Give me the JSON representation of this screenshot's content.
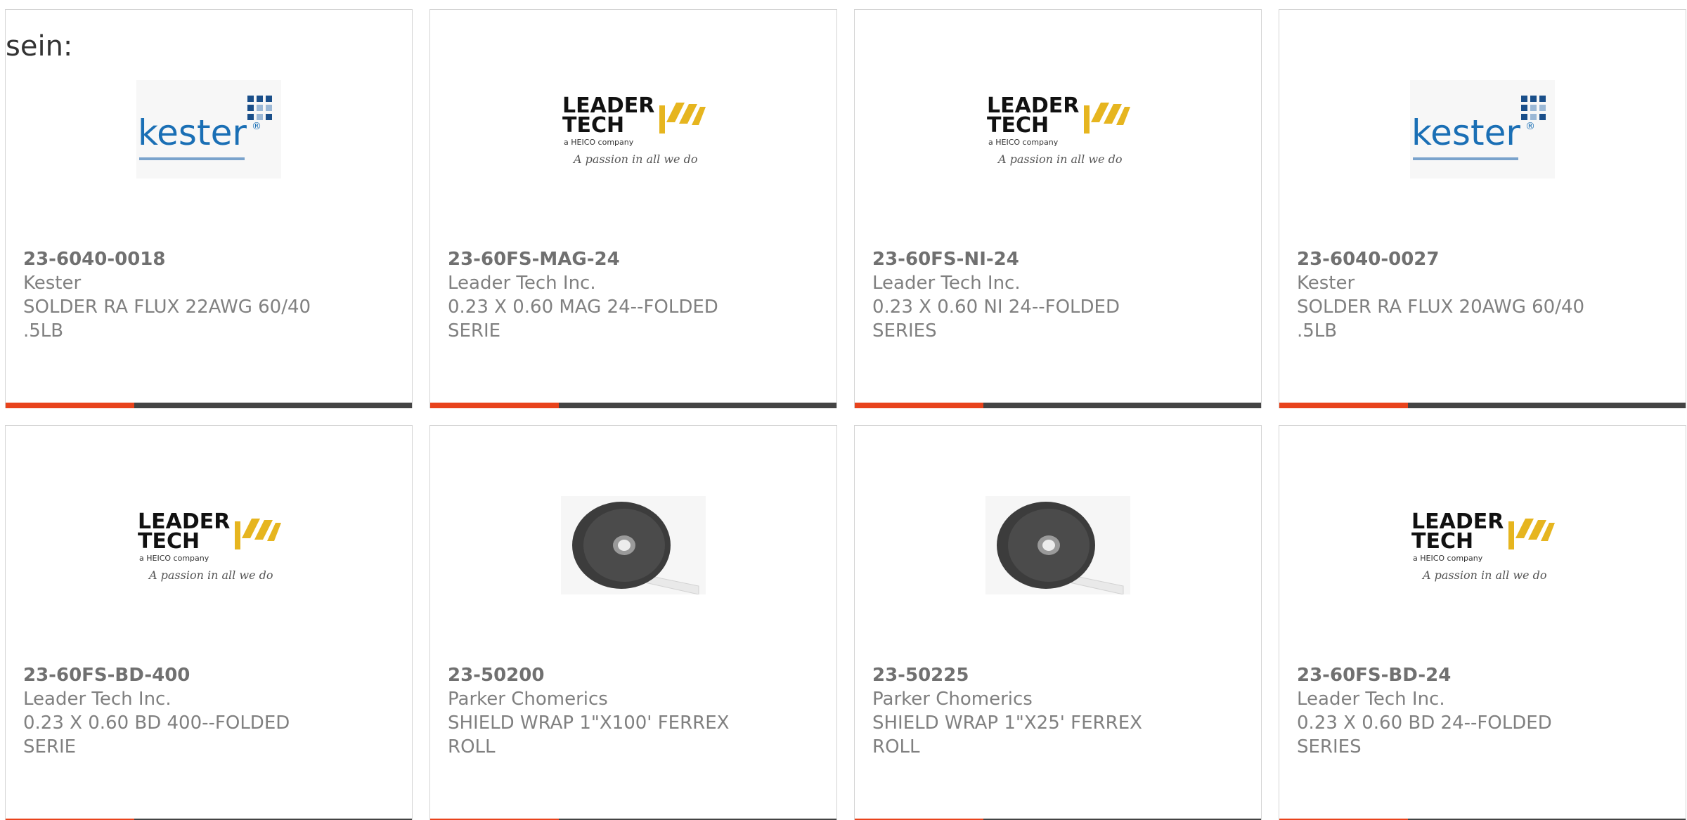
{
  "intro_text": "sein:",
  "colors": {
    "accent_bar": "#e8431c",
    "bar": "#444444",
    "card_border": "#d4d4d4",
    "kester_blue": "#1a6fb5",
    "leadertech_yellow": "#e6b51f"
  },
  "products": [
    {
      "part_number": "23-6040-0018",
      "manufacturer": "Kester",
      "description": "SOLDER RA FLUX 22AWG 60/40 .5LB",
      "image": "kester-logo"
    },
    {
      "part_number": "23-60FS-MAG-24",
      "manufacturer": "Leader Tech Inc.",
      "description": "0.23 X 0.60 MAG 24--FOLDED SERIE",
      "image": "leader-tech-logo"
    },
    {
      "part_number": "23-60FS-NI-24",
      "manufacturer": "Leader Tech Inc.",
      "description": "0.23 X 0.60 NI 24--FOLDED SERIES",
      "image": "leader-tech-logo"
    },
    {
      "part_number": "23-6040-0027",
      "manufacturer": "Kester",
      "description": "SOLDER RA FLUX 20AWG 60/40 .5LB",
      "image": "kester-logo"
    },
    {
      "part_number": "23-60FS-BD-400",
      "manufacturer": "Leader Tech Inc.",
      "description": "0.23 X 0.60 BD 400--FOLDED SERIE",
      "image": "leader-tech-logo"
    },
    {
      "part_number": "23-50200",
      "manufacturer": "Parker Chomerics",
      "description": "SHIELD WRAP 1\"X100' FERREX ROLL",
      "image": "tape-roll-photo"
    },
    {
      "part_number": "23-50225",
      "manufacturer": "Parker Chomerics",
      "description": "SHIELD WRAP 1\"X25' FERREX ROLL",
      "image": "tape-roll-photo"
    },
    {
      "part_number": "23-60FS-BD-24",
      "manufacturer": "Leader Tech Inc.",
      "description": "0.23 X 0.60 BD 24--FOLDED SERIES",
      "image": "leader-tech-logo"
    }
  ]
}
